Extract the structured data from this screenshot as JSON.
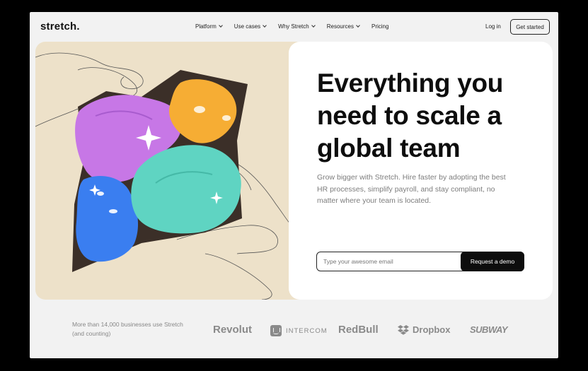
{
  "nav": {
    "logo": "stretch.",
    "items": [
      {
        "label": "Platform"
      },
      {
        "label": "Use cases"
      },
      {
        "label": "Why Stretch"
      },
      {
        "label": "Resources"
      },
      {
        "label": "Pricing"
      }
    ],
    "login": "Log in",
    "cta": "Get started"
  },
  "hero": {
    "headline": "Everything you need to scale a global team",
    "subtext": "Grow bigger with Stretch. Hire faster by adopting the best HR processes, simplify payroll, and stay compliant, no matter where your team is located.",
    "email_placeholder": "Type your awesome email",
    "demo_button": "Request a demo"
  },
  "logos": {
    "tagline": "More than 14,000 businesses use Stretch (and counting)",
    "brands": [
      "Revolut",
      "INTERCOM",
      "RedBull",
      "Dropbox",
      "SUBWAY"
    ]
  },
  "colors": {
    "art_bg": "#ede1c9",
    "blob_purple": "#c777e6",
    "blob_orange": "#f6ad34",
    "blob_blue": "#3a7ef0",
    "blob_teal": "#5fd4c2",
    "cta_bg": "#0d0d0d"
  }
}
